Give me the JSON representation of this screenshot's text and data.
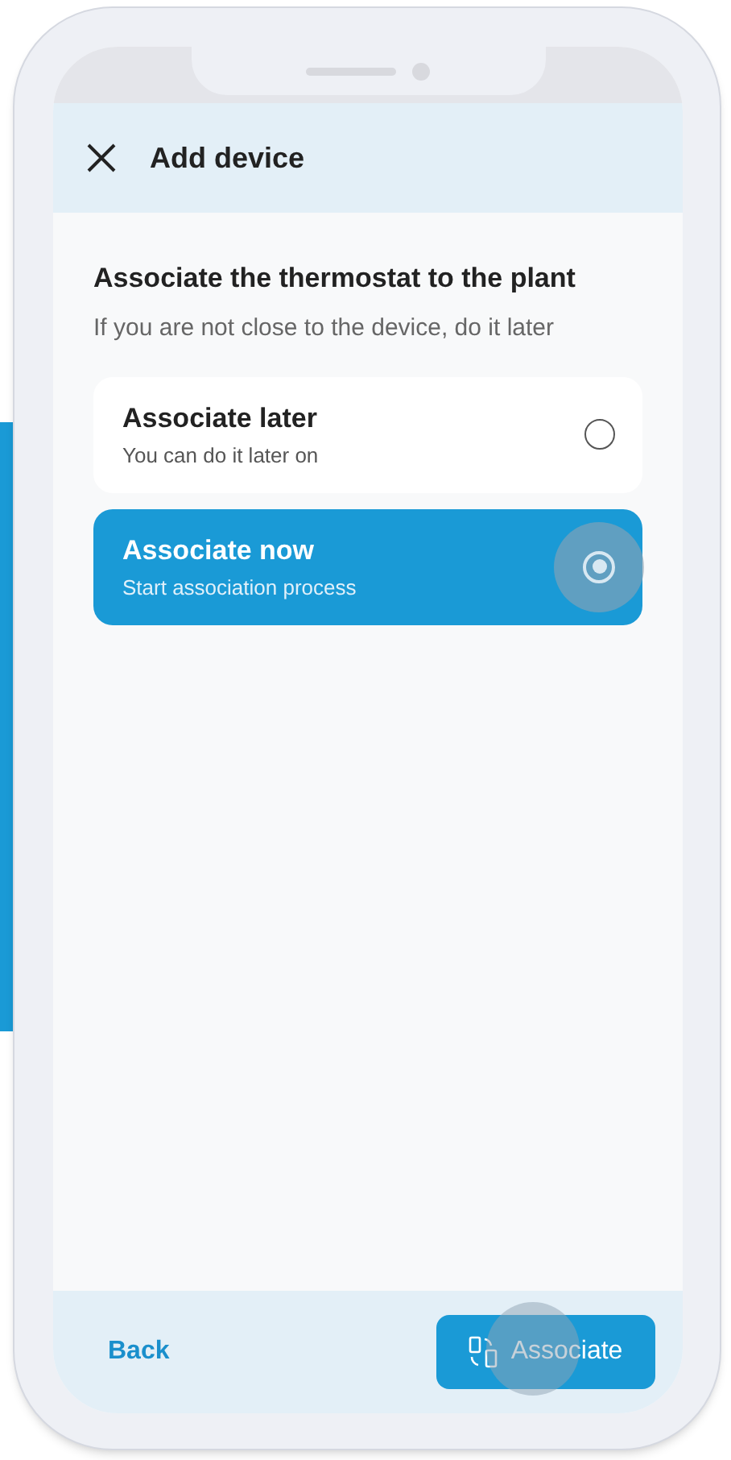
{
  "header": {
    "title": "Add device"
  },
  "heading": "Associate the thermostat to the plant",
  "subheading": "If you are not close to the device, do it later",
  "options": [
    {
      "title": "Associate later",
      "subtitle": "You can do it later on",
      "selected": false
    },
    {
      "title": "Associate now",
      "subtitle": "Start association process",
      "selected": true
    }
  ],
  "footer": {
    "back": "Back",
    "primary": "Associate"
  }
}
